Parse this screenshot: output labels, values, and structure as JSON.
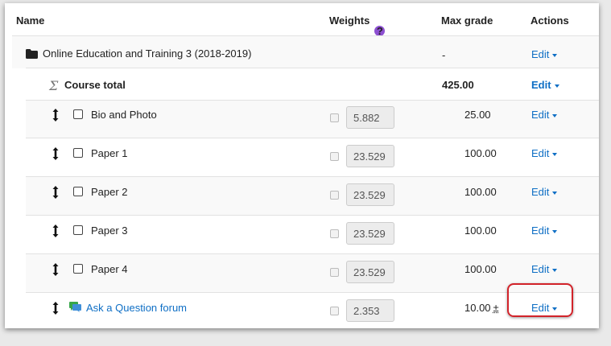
{
  "header": {
    "name": "Name",
    "weights": "Weights",
    "weights_help_icon": "question-circle-icon",
    "max_grade": "Max grade",
    "actions": "Actions"
  },
  "category": {
    "icon": "folder-icon",
    "name": "Online Education and Training 3 (2018-2019)",
    "max_grade": "-",
    "action": "Edit"
  },
  "course_total": {
    "icon": "sigma-icon",
    "name": "Course total",
    "max_grade": "425.00",
    "action": "Edit"
  },
  "items": [
    {
      "name": "Bio and Photo",
      "weight": "5.882",
      "max_grade": "25.00",
      "action": "Edit"
    },
    {
      "name": "Paper 1",
      "weight": "23.529",
      "max_grade": "100.00",
      "action": "Edit"
    },
    {
      "name": "Paper 2",
      "weight": "23.529",
      "max_grade": "100.00",
      "action": "Edit"
    },
    {
      "name": "Paper 3",
      "weight": "23.529",
      "max_grade": "100.00",
      "action": "Edit"
    },
    {
      "name": "Paper 4",
      "weight": "23.529",
      "max_grade": "100.00",
      "action": "Edit"
    },
    {
      "name": "Ask a Question forum",
      "icon": "forum-icon",
      "weight": "2.353",
      "max_grade": "10.00",
      "max_grade_suffix": "±",
      "action": "Edit"
    }
  ],
  "colors": {
    "link": "#0f6fc5",
    "help": "#8d4fd1",
    "highlight": "#d2232a"
  }
}
